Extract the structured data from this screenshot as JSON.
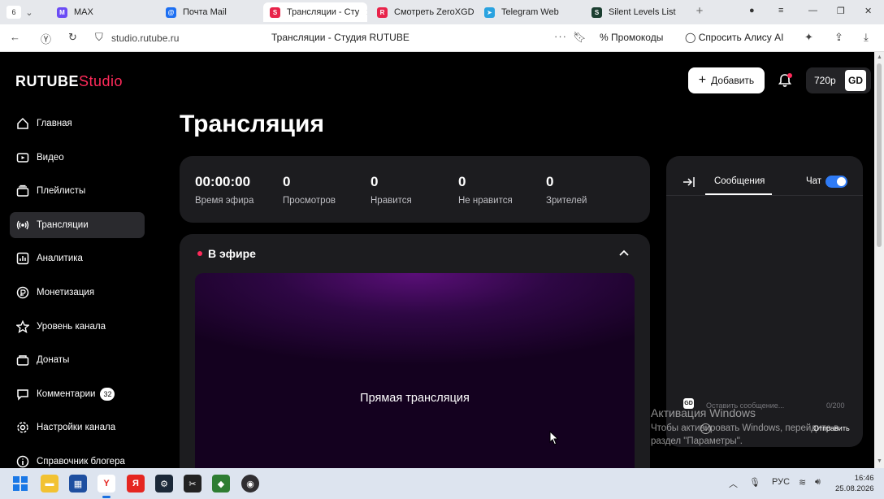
{
  "browser": {
    "tab_count": "6",
    "tabs": [
      {
        "label": "MAX",
        "color": "#6b4cf5",
        "glyph": "M"
      },
      {
        "label": "Почта Mail",
        "color": "#1d6ff2",
        "glyph": "@"
      },
      {
        "label": "Трансляции - Сту",
        "color": "#e8234a",
        "glyph": "S",
        "active": true
      },
      {
        "label": "Смотреть ZeroXGD",
        "color": "#e8234a",
        "glyph": "R"
      },
      {
        "label": "Telegram Web",
        "color": "#2aa3e0",
        "glyph": "➤"
      },
      {
        "label": "Silent Levels List",
        "color": "#1a3d2f",
        "glyph": "S"
      }
    ],
    "url": "studio.rutube.ru",
    "page_title": "Трансляции - Студия RUTUBE",
    "promo_label": "Промокоды",
    "alice_label": "Спросить Алису AI"
  },
  "app": {
    "logo_main": "RUTUBE",
    "logo_sub": "Studio",
    "add_button": "Добавить",
    "quality": "720p",
    "avatar_text": "GD",
    "sidebar": [
      {
        "label": "Главная",
        "icon": "home-icon"
      },
      {
        "label": "Видео",
        "icon": "video-icon"
      },
      {
        "label": "Плейлисты",
        "icon": "playlist-icon"
      },
      {
        "label": "Трансляции",
        "icon": "broadcast-icon",
        "active": true
      },
      {
        "label": "Аналитика",
        "icon": "analytics-icon"
      },
      {
        "label": "Монетизация",
        "icon": "monetization-icon"
      },
      {
        "label": "Уровень канала",
        "icon": "star-icon"
      },
      {
        "label": "Донаты",
        "icon": "donate-icon"
      },
      {
        "label": "Комментарии",
        "icon": "comment-icon",
        "badge": "32"
      },
      {
        "label": "Настройки канала",
        "icon": "gear-icon"
      },
      {
        "label": "Справочник блогера",
        "icon": "info-icon"
      }
    ],
    "page_title": "Трансляция",
    "stats": [
      {
        "value": "00:00:00",
        "label": "Время эфира"
      },
      {
        "value": "0",
        "label": "Просмотров"
      },
      {
        "value": "0",
        "label": "Нравится"
      },
      {
        "value": "0",
        "label": "Не нравится"
      },
      {
        "value": "0",
        "label": "Зрителей"
      }
    ],
    "live_title": "В эфире",
    "player_label": "Прямая трансляция",
    "chat": {
      "tab_messages": "Сообщения",
      "toggle_label": "Чат",
      "input_placeholder": "Оставить сообщение...",
      "counter": "0/200",
      "send_label": "Отправить"
    },
    "watermark": {
      "title": "Активация Windows",
      "text": "Чтобы активировать Windows, перейдите в раздел \"Параметры\"."
    }
  },
  "taskbar": {
    "lang": "РУС",
    "time": "16:46",
    "date": "25.08.2026"
  },
  "colors": {
    "accent": "#ff2a5a",
    "toggle": "#2f7bf5",
    "card": "#1c1c1f"
  }
}
